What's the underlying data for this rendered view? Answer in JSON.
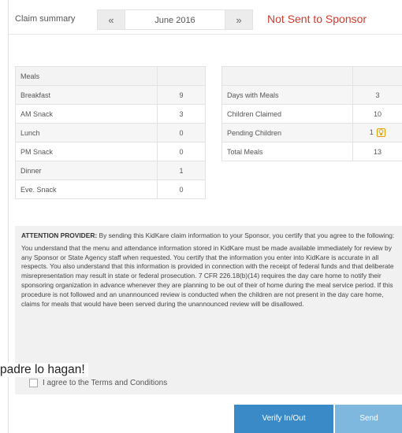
{
  "header": {
    "title": "Claim summary",
    "prev": "«",
    "month": "June 2016",
    "next": "»",
    "status": "Not Sent to Sponsor"
  },
  "meals": {
    "header": "Meals",
    "rows": [
      {
        "label": "Breakfast",
        "value": "9"
      },
      {
        "label": "AM Snack",
        "value": "3"
      },
      {
        "label": "Lunch",
        "value": "0"
      },
      {
        "label": "PM Snack",
        "value": "0"
      },
      {
        "label": "Dinner",
        "value": "1"
      },
      {
        "label": "Eve. Snack",
        "value": "0"
      }
    ]
  },
  "summary": {
    "rows": [
      {
        "label": "Days with Meals",
        "value": "3"
      },
      {
        "label": "Children Claimed",
        "value": "10"
      },
      {
        "label": "Pending Children",
        "value": "1"
      },
      {
        "label": "Total Meals",
        "value": "13"
      }
    ],
    "pending_icon": "lightbulb-icon"
  },
  "attention": {
    "lead": "ATTENTION PROVIDER:",
    "intro": " By sending this KidKare claim information to your Sponsor, you certify that you agree to the following:",
    "body": "You understand that the menu and attendance information stored in KidKare must be made available immediately for review by any Sponsor or State Agency staff when requested. You certify that the information you enter into KidKare is accurate in all respects. You also understand that this information is provided in connection with the receipt of federal funds and that deliberate misrepresentation may result in state or federal prosecution. 7 CFR 226.18(b)(14) requires the day care home to notify their sponsoring organization in advance whenever they are planning to be out of their of home during the meal service period. If this procedure is not followed and an unannounced review is conducted when the children are not present in the day care home, claims for meals that would have been served during the unannounced review will be disallowed."
  },
  "overlay_text": "padre lo hagan!",
  "agree_label": "I agree to the Terms and Conditions",
  "buttons": {
    "verify": "Verify In/Out",
    "send": "Send"
  },
  "colors": {
    "status": "#d23b2e",
    "primary_button": "#3a8ac8",
    "send_button": "#7fb8de",
    "pending_icon": "#e0a000"
  }
}
